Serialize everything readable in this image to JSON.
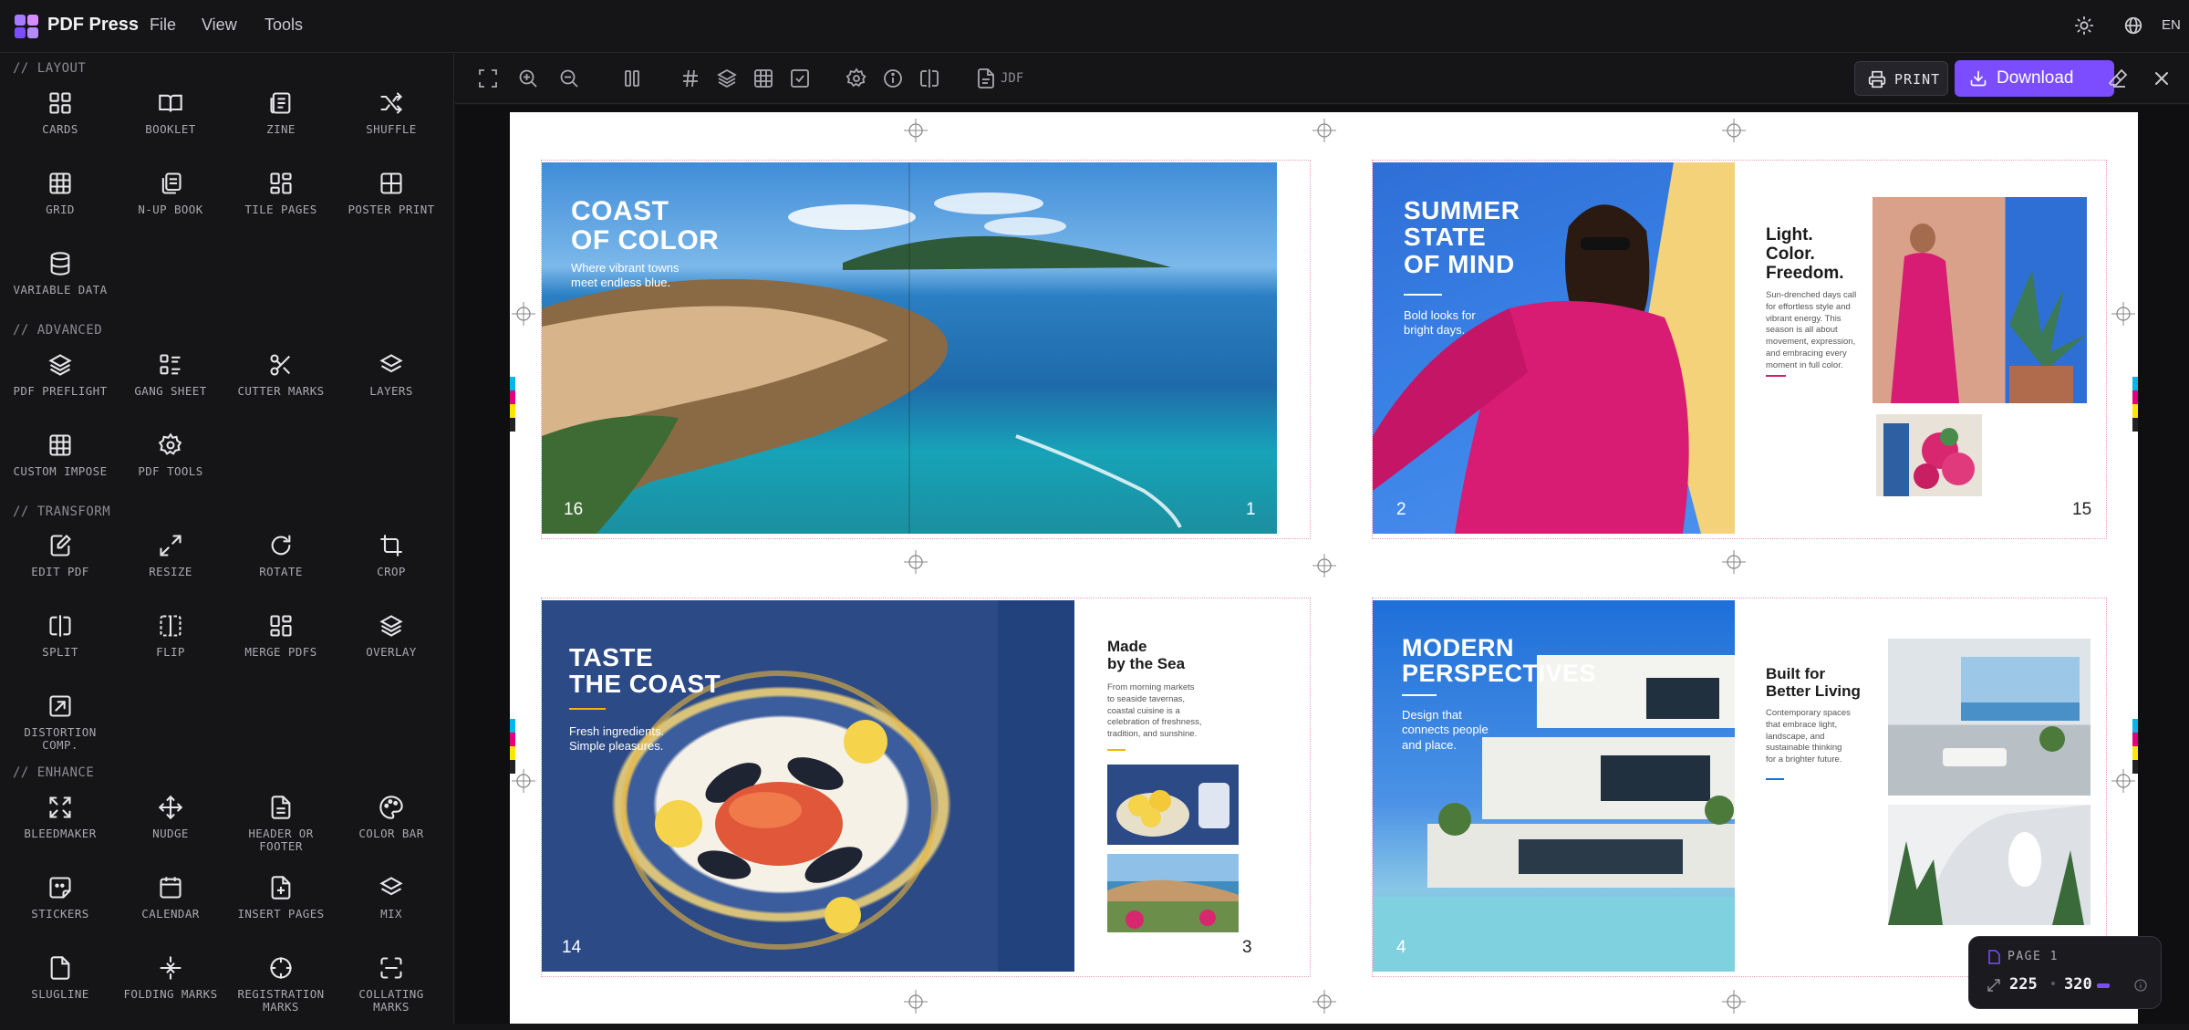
{
  "app": {
    "title": "PDF Press",
    "lang": "EN"
  },
  "menu": [
    "File",
    "View",
    "Tools"
  ],
  "sidebar": {
    "sections": [
      {
        "title": "// LAYOUT",
        "tools": [
          "CARDS",
          "BOOKLET",
          "ZINE",
          "SHUFFLE",
          "GRID",
          "N-UP BOOK",
          "TILE PAGES",
          "POSTER PRINT",
          "VARIABLE DATA"
        ]
      },
      {
        "title": "// ADVANCED",
        "tools": [
          "PDF PREFLIGHT",
          "GANG SHEET",
          "CUTTER MARKS",
          "LAYERS",
          "CUSTOM IMPOSE",
          "PDF TOOLS"
        ]
      },
      {
        "title": "// TRANSFORM",
        "tools": [
          "EDIT PDF",
          "RESIZE",
          "ROTATE",
          "CROP",
          "SPLIT",
          "FLIP",
          "MERGE PDFS",
          "OVERLAY",
          "DISTORTION COMP."
        ]
      },
      {
        "title": "// ENHANCE",
        "tools": [
          "BLEEDMAKER",
          "NUDGE",
          "HEADER OR FOOTER",
          "COLOR BAR",
          "STICKERS",
          "CALENDAR",
          "INSERT PAGES",
          "MIX",
          "SLUGLINE",
          "FOLDING MARKS",
          "REGISTRATION MARKS",
          "COLLATING MARKS"
        ]
      }
    ]
  },
  "toolbar": {
    "jdf_label": "JDF",
    "print_label": "PRINT",
    "download_label": "Download"
  },
  "spreads": {
    "s1": {
      "title_l1": "COAST",
      "title_l2": "OF COLOR",
      "sub_l1": "Where vibrant towns",
      "sub_l2": "meet endless blue.",
      "left_num": "16",
      "right_num": "1"
    },
    "s2": {
      "title_l1": "SUMMER",
      "title_l2": "STATE",
      "title_l3": "OF MIND",
      "sub_l1": "Bold looks for",
      "sub_l2": "bright days.",
      "left_num": "2",
      "right_num": "15",
      "r_title_l1": "Light.",
      "r_title_l2": "Color.",
      "r_title_l3": "Freedom.",
      "r_body": [
        "Sun-drenched days call",
        "for effortless style and",
        "vibrant energy. This",
        "season is all about",
        "movement, expression,",
        "and embracing every",
        "moment in full color."
      ]
    },
    "s3": {
      "title_l1": "TASTE",
      "title_l2": "THE COAST",
      "sub_l1": "Fresh ingredients.",
      "sub_l2": "Simple pleasures.",
      "left_num": "14",
      "right_num": "3",
      "r_title_l1": "Made",
      "r_title_l2": "by the Sea",
      "r_body": [
        "From morning markets",
        "to seaside tavernas,",
        "coastal cuisine is a",
        "celebration of freshness,",
        "tradition, and sunshine."
      ]
    },
    "s4": {
      "title_l1": "MODERN",
      "title_l2": "PERSPECTIVES",
      "sub_l1": "Design that",
      "sub_l2": "connects people",
      "sub_l3": "and place.",
      "left_num": "4",
      "r_title_l1": "Built for",
      "r_title_l2": "Better Living",
      "r_body": [
        "Contemporary spaces",
        "that embrace light,",
        "landscape, and",
        "sustainable thinking",
        "for a brighter future."
      ]
    }
  },
  "page_widget": {
    "label": "PAGE 1",
    "width": "225",
    "height": "320"
  },
  "colors": {
    "accent": "#7b4dff",
    "trim": "#f29ab4",
    "pink": "#d81b73",
    "yellow": "#f2b705",
    "blue": "#1e6fd9"
  }
}
